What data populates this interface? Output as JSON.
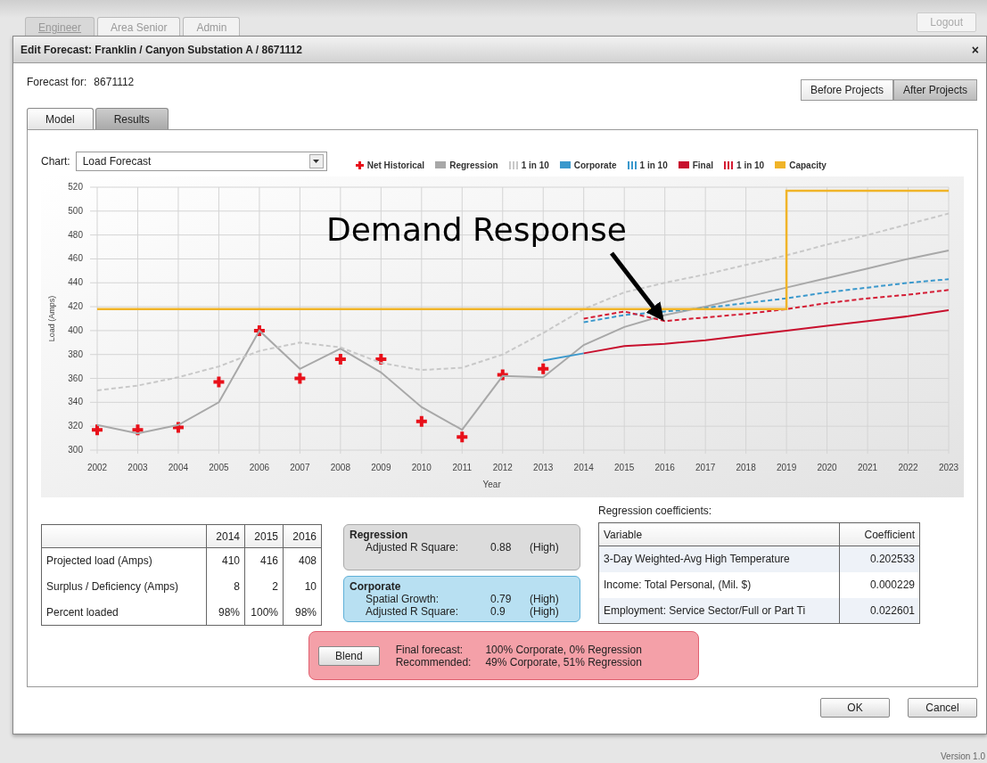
{
  "role_tabs": [
    {
      "label": "Engineer",
      "selected": true
    },
    {
      "label": "Area Senior",
      "selected": false
    },
    {
      "label": "Admin",
      "selected": false
    }
  ],
  "logout": "Logout",
  "dialog": {
    "title": "Edit Forecast: Franklin / Canyon Substation A / 8671112",
    "close": "×"
  },
  "forecast_for": {
    "label": "Forecast for:",
    "value": "8671112"
  },
  "project_toggle": [
    {
      "label": "Before Projects",
      "selected": false
    },
    {
      "label": "After Projects",
      "selected": true
    }
  ],
  "tabs": [
    {
      "label": "Model",
      "selected": false
    },
    {
      "label": "Results",
      "selected": true
    }
  ],
  "chart_select": {
    "label": "Chart:",
    "value": "Load Forecast"
  },
  "chart_data": {
    "type": "line",
    "xlabel": "Year",
    "ylabel": "Load (Amps)",
    "grid": true,
    "x": [
      2002,
      2003,
      2004,
      2005,
      2006,
      2007,
      2008,
      2009,
      2010,
      2011,
      2012,
      2013,
      2014,
      2015,
      2016,
      2017,
      2018,
      2019,
      2020,
      2021,
      2022,
      2023
    ],
    "xlim": [
      2002,
      2023
    ],
    "xticks": [
      2002,
      2003,
      2004,
      2005,
      2006,
      2007,
      2008,
      2009,
      2010,
      2011,
      2012,
      2013,
      2014,
      2015,
      2016,
      2017,
      2018,
      2019,
      2020,
      2021,
      2022,
      2023
    ],
    "ylim": [
      300,
      520
    ],
    "yticks": [
      300,
      320,
      340,
      360,
      380,
      400,
      420,
      440,
      460,
      480,
      500,
      520
    ],
    "series": [
      {
        "name": "Net Historical",
        "color": "#e8101a",
        "type": "scatter",
        "values": [
          317,
          317,
          319,
          357,
          400,
          360,
          376,
          376,
          324,
          311,
          363,
          368,
          null,
          null,
          null,
          null,
          null,
          null,
          null,
          null,
          null,
          null
        ]
      },
      {
        "name": "Regression",
        "color": "#a8a8a8",
        "line_style": "solid",
        "values": [
          321,
          314,
          321,
          340,
          400,
          368,
          385,
          365,
          336,
          317,
          362,
          361,
          388,
          403,
          413,
          420,
          428,
          436,
          444,
          452,
          460,
          467
        ]
      },
      {
        "name": "1 in 10",
        "color": "#c8c8c8",
        "line_style": "dashed",
        "values": [
          350,
          354,
          361,
          370,
          383,
          390,
          386,
          373,
          367,
          369,
          380,
          398,
          418,
          432,
          440,
          447,
          455,
          463,
          472,
          480,
          489,
          498
        ]
      },
      {
        "name": "Corporate",
        "color": "#3a98cc",
        "line_style": "solid",
        "values": [
          null,
          null,
          null,
          null,
          null,
          null,
          null,
          null,
          null,
          null,
          null,
          375,
          381,
          null,
          null,
          null,
          null,
          null,
          null,
          null,
          null,
          null
        ]
      },
      {
        "name": "1 in 10",
        "color": "#3a98cc",
        "line_style": "dashed",
        "values": [
          null,
          null,
          null,
          null,
          null,
          null,
          null,
          null,
          null,
          null,
          null,
          null,
          407,
          413,
          416,
          419,
          423,
          427,
          432,
          436,
          440,
          443
        ]
      },
      {
        "name": "Final",
        "color": "#c8102e",
        "line_style": "solid",
        "values": [
          null,
          null,
          null,
          null,
          null,
          null,
          null,
          null,
          null,
          null,
          null,
          null,
          381,
          387,
          389,
          392,
          396,
          400,
          404,
          408,
          412,
          417
        ]
      },
      {
        "name": "1 in 10",
        "color": "#d41c34",
        "line_style": "dashed",
        "values": [
          null,
          null,
          null,
          null,
          null,
          null,
          null,
          null,
          null,
          null,
          null,
          null,
          410,
          416,
          408,
          411,
          414,
          418,
          423,
          427,
          430,
          434
        ]
      },
      {
        "name": "Capacity",
        "color": "#f0b428",
        "line_style": "solid",
        "x": [
          2002,
          2019,
          2019,
          2023
        ],
        "values": [
          418,
          418,
          517,
          517
        ]
      }
    ],
    "annotations": [
      {
        "text": "Demand Response",
        "x": 2016,
        "y": 408
      }
    ]
  },
  "projection_table": {
    "columns": [
      "2014",
      "2015",
      "2016"
    ],
    "rows": [
      {
        "label": "Projected load (Amps)",
        "values": [
          "410",
          "416",
          "408"
        ]
      },
      {
        "label": "Surplus / Deficiency (Amps)",
        "values": [
          "8",
          "2",
          "10"
        ]
      },
      {
        "label": "Percent loaded",
        "values": [
          "98%",
          "100%",
          "98%"
        ]
      }
    ]
  },
  "fit_boxes": [
    {
      "kind": "regression",
      "title": "Regression",
      "rows": [
        {
          "label": "Adjusted R Square:",
          "value": "0.88",
          "rating": "(High)"
        }
      ]
    },
    {
      "kind": "corporate",
      "title": "Corporate",
      "rows": [
        {
          "label": "Spatial Growth:",
          "value": "0.79",
          "rating": "(High)"
        },
        {
          "label": "Adjusted R Square:",
          "value": "0.9",
          "rating": "(High)"
        }
      ]
    }
  ],
  "blend": {
    "button": "Blend",
    "rows": [
      {
        "label": "Final forecast:",
        "value": "100% Corporate, 0% Regression"
      },
      {
        "label": "Recommended:",
        "value": "49% Corporate, 51% Regression"
      }
    ]
  },
  "coefficients": {
    "title": "Regression coefficients:",
    "columns": [
      "Variable",
      "Coefficient"
    ],
    "rows": [
      {
        "variable": "3-Day Weighted-Avg High Temperature",
        "coefficient": "0.202533"
      },
      {
        "variable": "Income: Total Personal, (Mil. $)",
        "coefficient": "0.000229"
      },
      {
        "variable": "Employment: Service Sector/Full or Part Ti",
        "coefficient": "0.022601"
      }
    ]
  },
  "buttons": [
    "OK",
    "Cancel"
  ],
  "version": "Version 1.0"
}
